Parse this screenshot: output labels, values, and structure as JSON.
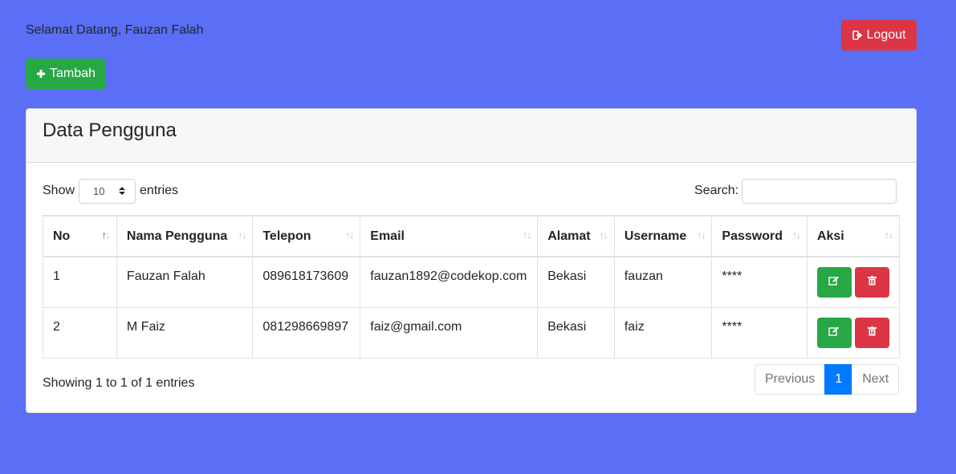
{
  "header": {
    "welcome_text": "Selamat Datang, Fauzan Falah",
    "logout_label": "Logout",
    "add_label": "Tambah"
  },
  "card": {
    "title": "Data Pengguna",
    "show_label": "Show",
    "entries_value": "10",
    "entries_label": "entries",
    "search_label": "Search:",
    "search_value": ""
  },
  "table": {
    "columns": [
      "No",
      "Nama Pengguna",
      "Telepon",
      "Email",
      "Alamat",
      "Username",
      "Password",
      "Aksi"
    ],
    "rows": [
      [
        "1",
        "Fauzan Falah",
        "089618173609",
        "fauzan1892@codekop.com",
        "Bekasi",
        "fauzan",
        "****"
      ],
      [
        "2",
        "M Faiz",
        "081298669897",
        "faiz@gmail.com",
        "Bekasi",
        "faiz",
        "****"
      ]
    ]
  },
  "footer": {
    "info": "Showing 1 to 1 of 1 entries",
    "previous_label": "Previous",
    "current_page": "1",
    "next_label": "Next"
  },
  "colors": {
    "background": "#5a6ef6",
    "success": "#28a745",
    "danger": "#dc3545",
    "primary": "#007bff"
  },
  "icons": {
    "logout": "sign-out-icon",
    "add": "plus-icon",
    "edit": "edit-icon",
    "delete": "trash-icon",
    "sort": "sort-icon"
  }
}
